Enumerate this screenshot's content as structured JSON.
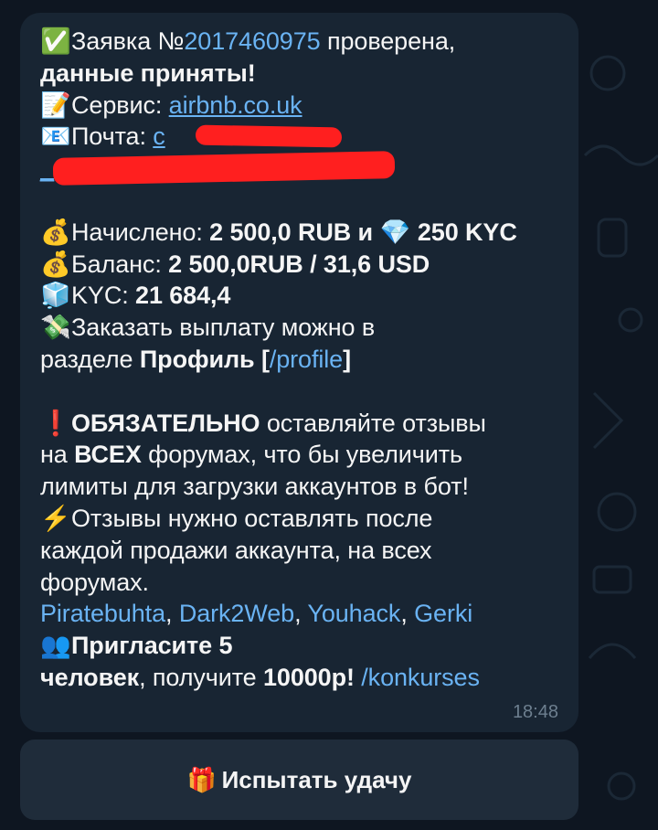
{
  "message": {
    "l1_emoji": "✅",
    "l1_pre": "Заявка №",
    "l1_id": "2017460975",
    "l1_post": " проверена,",
    "l2": "данные приняты!",
    "service_emoji": "📝",
    "service_label": "Сервис: ",
    "service_link": "airbnb.co.uk",
    "mail_emoji": "📧",
    "mail_label": "Почта: ",
    "mail_link_visible": "c",
    "mail_line2_visible": "_",
    "accrued_emoji": "💰",
    "accrued_label": "Начислено: ",
    "accrued_value": "2 500,0 RUB и ",
    "diamond_emoji": "💎",
    "kyc_accrued": " 250 KYC",
    "balance_emoji": "💰",
    "balance_label": "Баланс: ",
    "balance_value": "2 500,0RUB  / 31,6 USD",
    "kyc_emoji": "🧊",
    "kyc_label": "KYC: ",
    "kyc_value": "21 684,4",
    "payout_emoji": "💸",
    "payout_l1": "Заказать выплату можно в",
    "payout_l2_pre": "разделе ",
    "payout_profile": "Профиль [",
    "payout_cmd": "/profile",
    "payout_close": "]",
    "warn_emoji": "❗",
    "warn_bold": "ОБЯЗАТЕЛЬНО",
    "warn_rest": " оставляйте отзывы",
    "warn_l2_pre": "на ",
    "warn_l2_bold": "ВСЕХ",
    "warn_l2_post": " форумах, что бы увеличить",
    "warn_l3": "лимиты для загрузки аккаунтов в бот!",
    "bolt_emoji": "⚡",
    "bolt_l1": "Отзывы нужно оставлять после",
    "bolt_l2": "каждой продажи аккаунта, на всех",
    "bolt_l3": "форумах.",
    "forum1": "Piratebuhta",
    "forum2": "Dark2Web",
    "forum3": "Youhack",
    "forum4": "Gerki",
    "comma": ", ",
    "invite_emoji": "👥",
    "invite_l1": "Пригласите 5",
    "invite_l2_bold": "человек",
    "invite_l2_mid": ", получите ",
    "invite_l2_bold2": "10000р!",
    "invite_cmd": "/konkurses",
    "time": "18:48"
  },
  "keyboard": {
    "emoji": "🎁",
    "label": "Испытать удачу"
  },
  "colors": {
    "background": "#0e1621",
    "bubble": "#182533",
    "link": "#6ab3f3",
    "redaction": "#ff1f1f"
  }
}
